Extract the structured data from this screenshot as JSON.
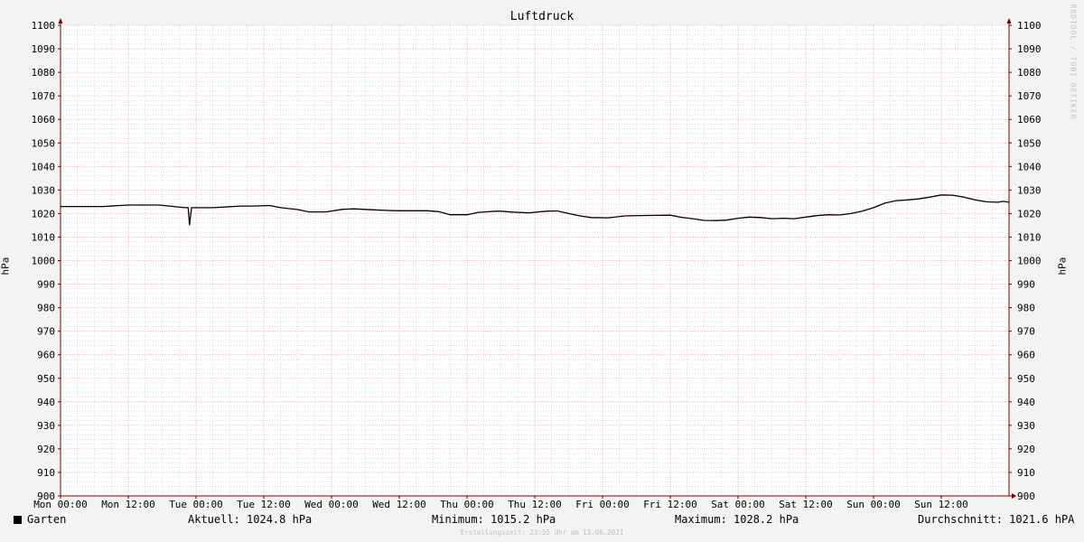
{
  "chart_data": {
    "type": "line",
    "title": "Luftdruck",
    "ylabel": "hPa",
    "ylim": [
      900,
      1100
    ],
    "yticks": [
      900,
      910,
      920,
      930,
      940,
      950,
      960,
      970,
      980,
      990,
      1000,
      1010,
      1020,
      1030,
      1040,
      1050,
      1060,
      1070,
      1080,
      1090,
      1100
    ],
    "xlim_hours": [
      0,
      168
    ],
    "xticks": [
      {
        "label": "Mon 00:00",
        "hour": 0
      },
      {
        "label": "Mon 12:00",
        "hour": 12
      },
      {
        "label": "Tue 00:00",
        "hour": 24
      },
      {
        "label": "Tue 12:00",
        "hour": 36
      },
      {
        "label": "Wed 00:00",
        "hour": 48
      },
      {
        "label": "Wed 12:00",
        "hour": 60
      },
      {
        "label": "Thu 00:00",
        "hour": 72
      },
      {
        "label": "Thu 12:00",
        "hour": 84
      },
      {
        "label": "Fri 00:00",
        "hour": 96
      },
      {
        "label": "Fri 12:00",
        "hour": 108
      },
      {
        "label": "Sat 00:00",
        "hour": 120
      },
      {
        "label": "Sat 12:00",
        "hour": 132
      },
      {
        "label": "Sun 00:00",
        "hour": 144
      },
      {
        "label": "Sun 12:00",
        "hour": 156
      }
    ],
    "grid": true,
    "series": [
      {
        "name": "Garten",
        "color": "#000000",
        "x": [
          0,
          4,
          7.5,
          12,
          14,
          17.5,
          22,
          22.6,
          22.85,
          23.2,
          27,
          32,
          34,
          37,
          39,
          42,
          44,
          47,
          50,
          52,
          55,
          58,
          60,
          62,
          65,
          67,
          69,
          72,
          74,
          77,
          78,
          80,
          83,
          86,
          88,
          90,
          92,
          94,
          97,
          100,
          104,
          108,
          110,
          112,
          114,
          116,
          118,
          120,
          122,
          124,
          126,
          128,
          130,
          132,
          134,
          136,
          138,
          140,
          142,
          144,
          146,
          148,
          150,
          152,
          154,
          156,
          158,
          160,
          162,
          164,
          166,
          167,
          168
        ],
        "y": [
          1023,
          1023,
          1023,
          1023.6,
          1023.6,
          1023.6,
          1022.5,
          1022.5,
          1015.2,
          1022.5,
          1022.5,
          1023.2,
          1023.2,
          1023.4,
          1022.5,
          1021.7,
          1020.7,
          1020.7,
          1021.8,
          1022,
          1021.6,
          1021.3,
          1021.2,
          1021.2,
          1021.2,
          1020.8,
          1019.5,
          1019.5,
          1020.5,
          1021,
          1021,
          1020.6,
          1020.3,
          1021,
          1021.1,
          1020,
          1019,
          1018.3,
          1018.2,
          1019,
          1019.2,
          1019.3,
          1018.4,
          1017.8,
          1017.1,
          1017,
          1017.2,
          1018,
          1018.5,
          1018.3,
          1017.8,
          1018,
          1017.8,
          1018.5,
          1019.1,
          1019.5,
          1019.4,
          1020,
          1021,
          1022.5,
          1024.4,
          1025.5,
          1025.8,
          1026.2,
          1027,
          1027.9,
          1027.8,
          1027,
          1025.8,
          1025,
          1024.8,
          1025.2,
          1024.8
        ]
      }
    ]
  },
  "legend": {
    "series_label": "Garten",
    "current": "Aktuell: 1024.8 hPa",
    "minimum": "Minimum: 1015.2 hPa",
    "maximum": "Maximum: 1028.2 hPa",
    "average": "Durchschnitt: 1021.6 hPA"
  },
  "watermark": "RRDTOOL / TOBI OETIKER",
  "footer": "Erstellungszeit: 23:55 Uhr am 13.06.2021",
  "colors": {
    "background": "#f3f3f3",
    "plot_background": "#ffffff",
    "major_grid": "#e6a3a3",
    "minor_grid": "#c8c8c8",
    "axis": "#7a0000",
    "line": "#000000"
  }
}
